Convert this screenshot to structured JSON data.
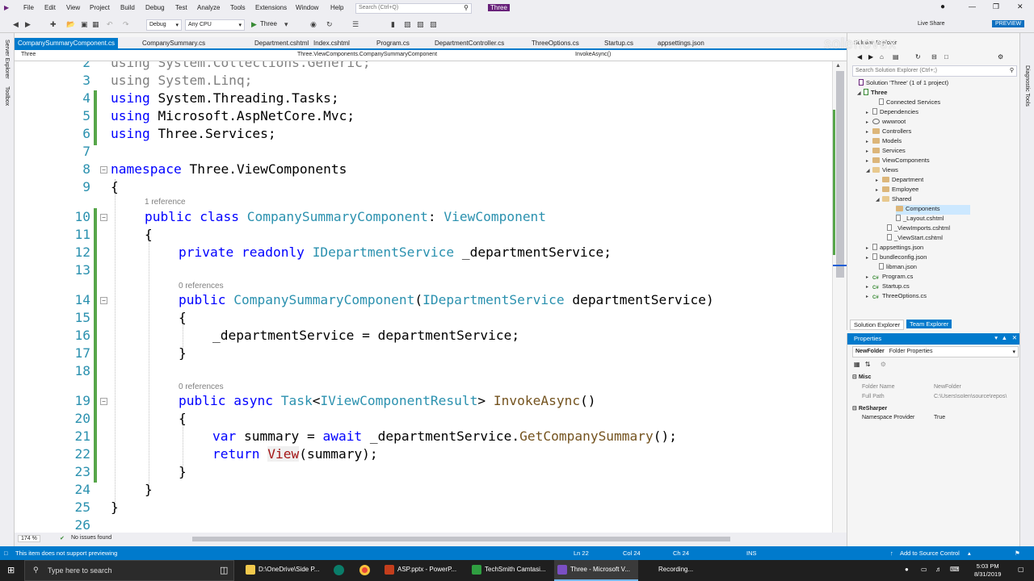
{
  "menu": [
    "File",
    "Edit",
    "View",
    "Project",
    "Build",
    "Debug",
    "Test",
    "Analyze",
    "Tools",
    "Extensions",
    "Window",
    "Help"
  ],
  "search_placeholder": "Search (Ctrl+Q)",
  "solution_badge": "Three",
  "toolbar": {
    "config": "Debug",
    "platform": "Any CPU",
    "run_target": "Three",
    "live_share": "Live Share",
    "preview": "PREVIEW"
  },
  "left_strip": [
    "Server Explorer",
    "Toolbox"
  ],
  "right_strip": [
    "Diagnostic Tools"
  ],
  "tabs": [
    "CompanySummaryComponent.cs",
    "CompanySummary.cs",
    "Department.cshtml",
    "Index.cshtml",
    "Program.cs",
    "DepartmentController.cs",
    "ThreeOptions.cs",
    "Startup.cs",
    "appsettings.json"
  ],
  "navbar": {
    "project": "Three",
    "type": "Three.ViewComponents.CompanySummaryComponent",
    "member": "InvokeAsync()"
  },
  "code": {
    "l2": "using System.Collections.Generic;",
    "l3": "using System.Linq;",
    "l4a": "using",
    "l4b": " System.Threading.Tasks;",
    "l5a": "using",
    "l5b": " Microsoft.AspNetCore.Mvc;",
    "l6a": "using",
    "l6b": " Three.Services;",
    "l8a": "namespace",
    "l8b": " Three.ViewComponents",
    "l9": "{",
    "lens10": "1 reference",
    "l10a": "public class",
    "l10b": "CompanySummaryComponent",
    "l10c": ": ",
    "l10d": "ViewComponent",
    "l11": "{",
    "l12a": "private readonly",
    "l12b": "IDepartmentService",
    "l12c": " _departmentService;",
    "lens14": "0 references",
    "l14a": "public",
    "l14b": "CompanySummaryComponent",
    "l14c": "(",
    "l14d": "IDepartmentService",
    "l14e": " departmentService)",
    "l15": "{",
    "l16": "_departmentService = departmentService;",
    "l17": "}",
    "lens19": "0 references",
    "l19a": "public async",
    "l19b": "Task",
    "l19c": "<",
    "l19d": "IViewComponentResult",
    "l19e": ">",
    "l19f": "InvokeAsync",
    "l19g": "()",
    "l20": "{",
    "l21a": "var",
    "l21b": " summary = ",
    "l21c": "await",
    "l21d": " _departmentService.",
    "l21e": "GetCompanySummary",
    "l21f": "();",
    "l22a": "return",
    "l22b": "View",
    "l22c": "(summary);",
    "l23": "}",
    "l24": "}",
    "l25": "}"
  },
  "line_numbers": [
    "2",
    "3",
    "4",
    "5",
    "6",
    "7",
    "8",
    "9",
    "10",
    "11",
    "12",
    "13",
    "14",
    "15",
    "16",
    "17",
    "18",
    "19",
    "20",
    "21",
    "22",
    "23",
    "24",
    "25",
    "26"
  ],
  "editor_footer": {
    "zoom": "174 %",
    "issues": "No issues found"
  },
  "solution_explorer": {
    "title": "Solution Explorer",
    "search_placeholder": "Search Solution Explorer (Ctrl+;)",
    "items": [
      {
        "label": "Solution 'Three' (1 of 1 project)"
      },
      {
        "label": "Three"
      },
      {
        "label": "Connected Services"
      },
      {
        "label": "Dependencies"
      },
      {
        "label": "wwwroot"
      },
      {
        "label": "Controllers"
      },
      {
        "label": "Models"
      },
      {
        "label": "Services"
      },
      {
        "label": "ViewComponents"
      },
      {
        "label": "Views"
      },
      {
        "label": "Department"
      },
      {
        "label": "Employee"
      },
      {
        "label": "Shared"
      },
      {
        "label": "Components"
      },
      {
        "label": "_Layout.cshtml"
      },
      {
        "label": "_ViewImports.cshtml"
      },
      {
        "label": "_ViewStart.cshtml"
      },
      {
        "label": "appsettings.json"
      },
      {
        "label": "bundleconfig.json"
      },
      {
        "label": "libman.json"
      },
      {
        "label": "Program.cs"
      },
      {
        "label": "Startup.cs"
      },
      {
        "label": "ThreeOptions.cs"
      }
    ],
    "tab_solution": "Solution Explorer",
    "tab_team": "Team Explorer"
  },
  "properties": {
    "title": "Properties",
    "object_name": "NewFolder",
    "object_type": "Folder Properties",
    "cat_misc": "Misc",
    "folder_name_label": "Folder Name",
    "folder_name_value": "NewFolder",
    "full_path_label": "Full Path",
    "full_path_value": "C:\\Users\\solen\\source\\repos\\",
    "cat_resharper": "ReSharper",
    "ns_provider_label": "Namespace Provider",
    "ns_provider_value": "True"
  },
  "status": {
    "message": "This item does not support previewing",
    "ln": "Ln 22",
    "col": "Col 24",
    "ch": "Ch 24",
    "ins": "INS",
    "source_control": "Add to Source Control"
  },
  "taskbar": {
    "search": "Type here to search",
    "tasks": [
      "D:\\OneDrive\\Side P...",
      "ASP.pptx - PowerP...",
      "TechSmith Camtasi...",
      "Three - Microsoft V...",
      "Recording..."
    ],
    "time": "5:03 PM",
    "date": "8/31/2019"
  },
  "watermark": "solenovex"
}
